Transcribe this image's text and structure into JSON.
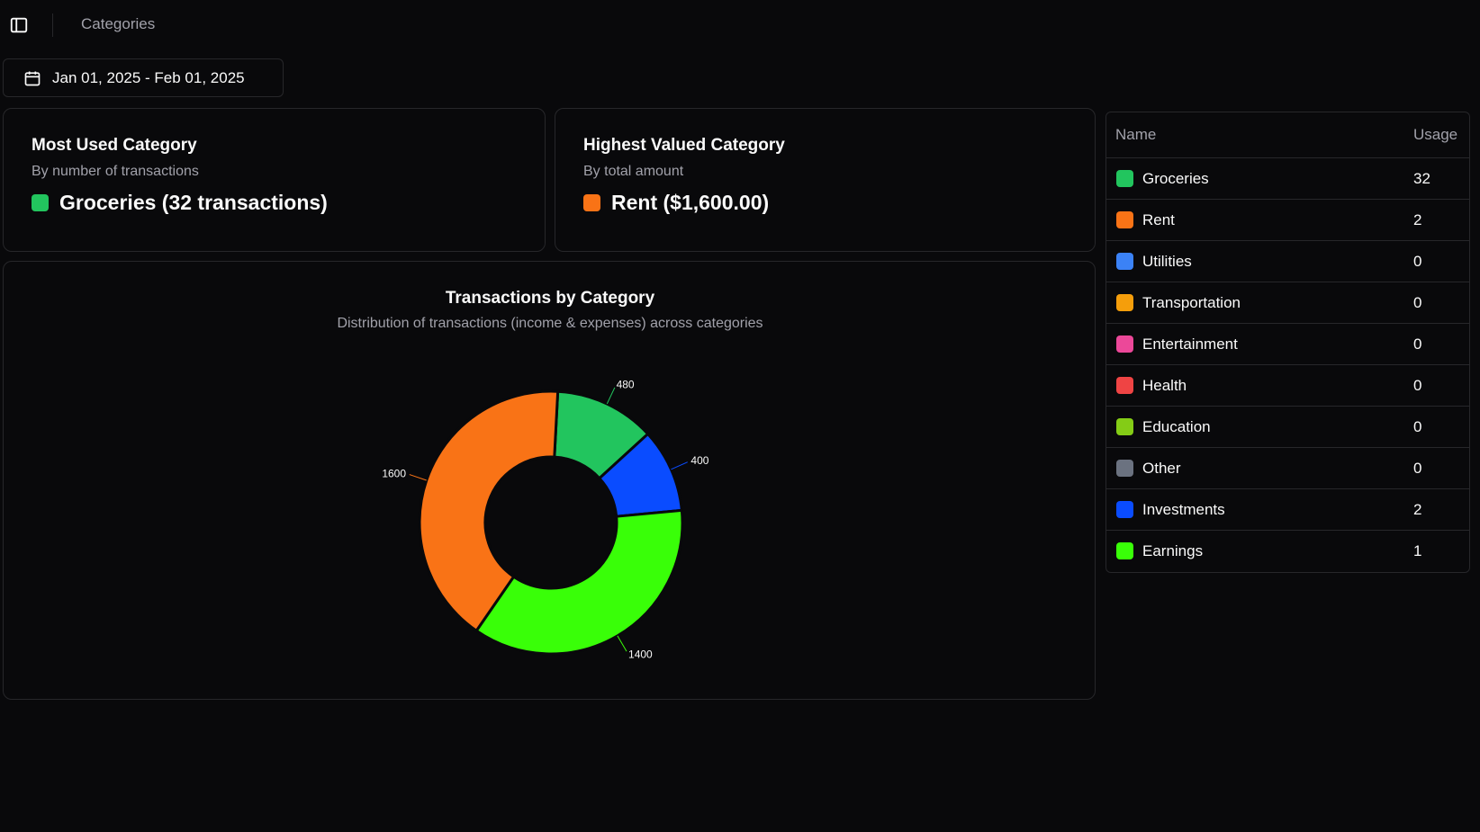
{
  "header": {
    "breadcrumb": "Categories",
    "date_range": "Jan 01, 2025 - Feb 01, 2025"
  },
  "cards": {
    "most_used": {
      "title": "Most Used Category",
      "subtitle": "By number of transactions",
      "value": "Groceries (32 transactions)",
      "color": "#22c55e"
    },
    "highest_valued": {
      "title": "Highest Valued Category",
      "subtitle": "By total amount",
      "value": "Rent ($1,600.00)",
      "color": "#f97316"
    }
  },
  "chart_data": {
    "type": "pie",
    "title": "Transactions by Category",
    "subtitle": "Distribution of transactions (income & expenses) across categories",
    "slices": [
      {
        "value": 480,
        "color": "#22c55e"
      },
      {
        "value": 400,
        "color": "#0a4cff"
      },
      {
        "value": 1400,
        "color": "#39ff08"
      },
      {
        "value": 1600,
        "color": "#f97316"
      }
    ]
  },
  "table": {
    "headers": [
      "Name",
      "Usage"
    ],
    "rows": [
      {
        "name": "Groceries",
        "usage": "32",
        "color": "#22c55e"
      },
      {
        "name": "Rent",
        "usage": "2",
        "color": "#f97316"
      },
      {
        "name": "Utilities",
        "usage": "0",
        "color": "#3b82f6"
      },
      {
        "name": "Transportation",
        "usage": "0",
        "color": "#f59e0b"
      },
      {
        "name": "Entertainment",
        "usage": "0",
        "color": "#ec4899"
      },
      {
        "name": "Health",
        "usage": "0",
        "color": "#ef4444"
      },
      {
        "name": "Education",
        "usage": "0",
        "color": "#84cc16"
      },
      {
        "name": "Other",
        "usage": "0",
        "color": "#6b7280"
      },
      {
        "name": "Investments",
        "usage": "2",
        "color": "#0a4cff"
      },
      {
        "name": "Earnings",
        "usage": "1",
        "color": "#39ff08"
      }
    ]
  }
}
